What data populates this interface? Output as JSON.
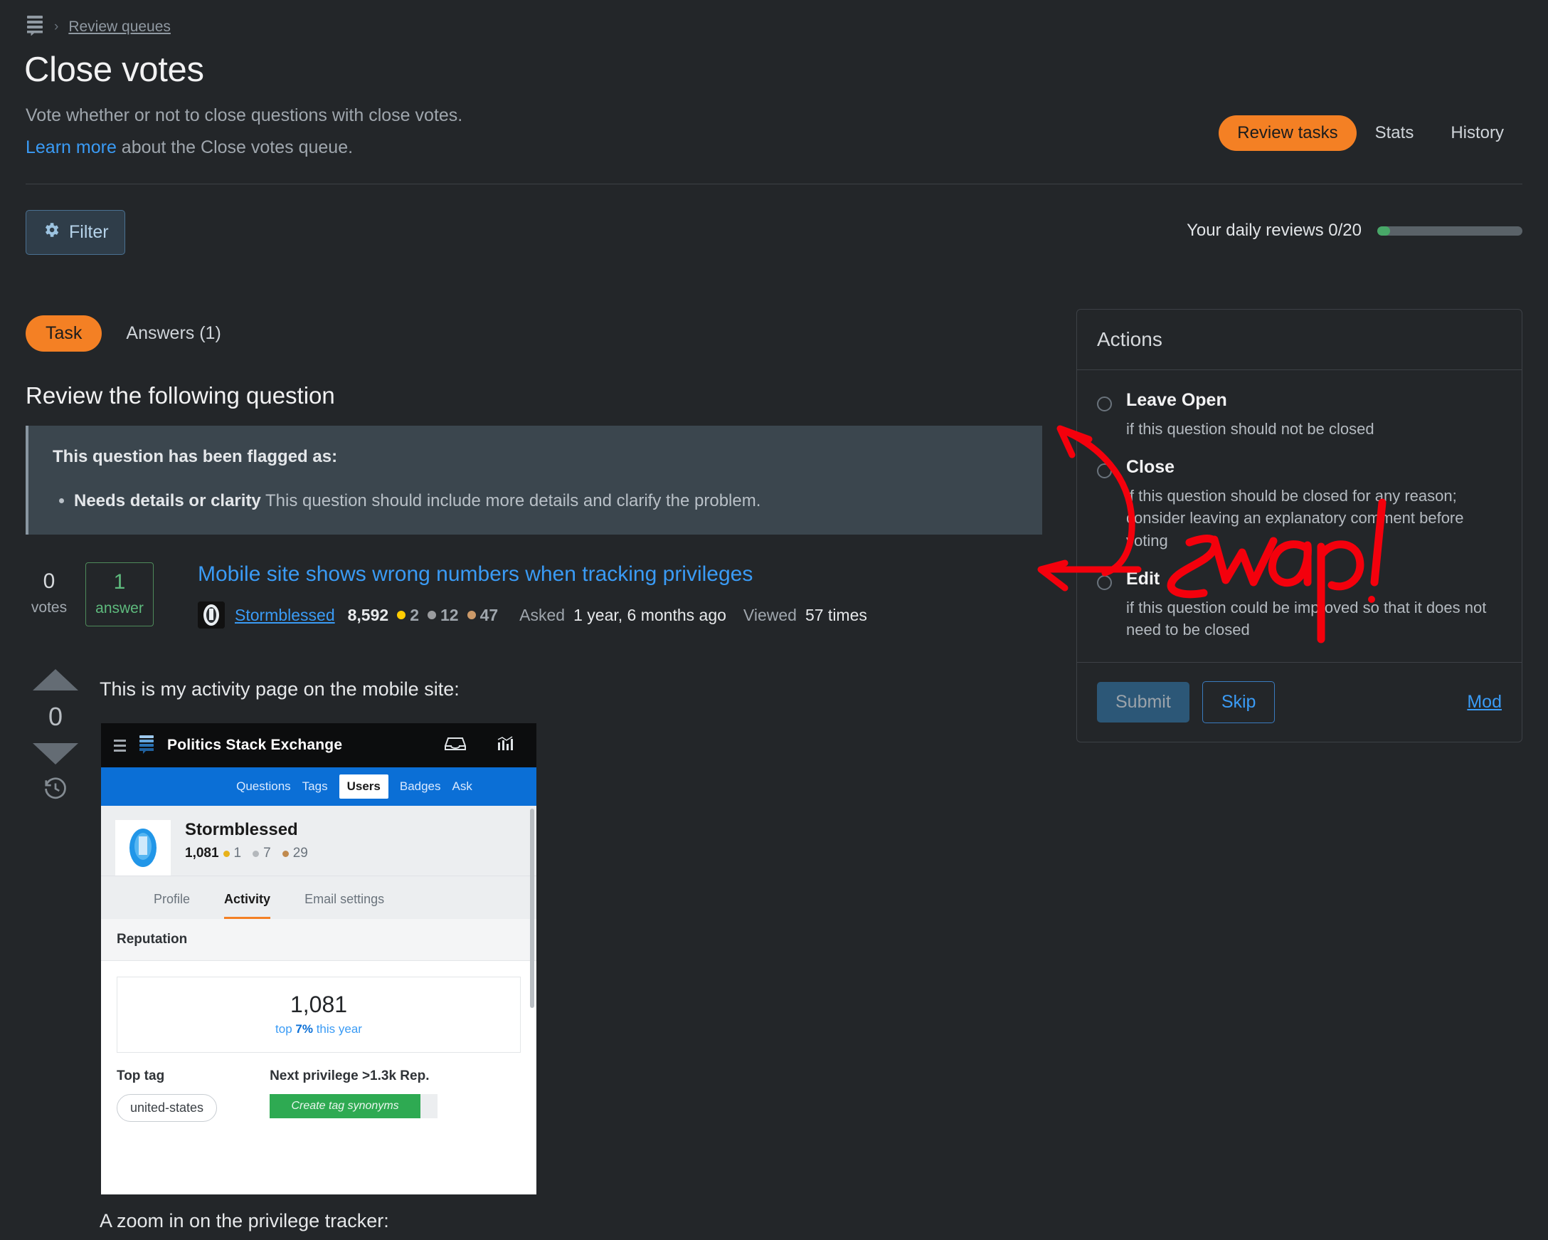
{
  "breadcrumb": {
    "logo": "stack-exchange-logo",
    "separator": "›",
    "item": "Review queues"
  },
  "header": {
    "title": "Close votes",
    "subtitle": "Vote whether or not to close questions with close votes.",
    "learn_more": "Learn more",
    "learn_more_rest": " about the Close votes queue."
  },
  "topnav": {
    "review_tasks": "Review tasks",
    "stats": "Stats",
    "history": "History",
    "accent": "#f48024"
  },
  "toolbar": {
    "filter_label": "Filter",
    "daily_label": "Your daily reviews 0/20",
    "daily_done": 0,
    "daily_total": 20
  },
  "tabs": {
    "task": "Task",
    "answers": "Answers (1)"
  },
  "main": {
    "section_title": "Review the following question",
    "flag_heading": "This question has been flagged as:",
    "flag_items": [
      {
        "title": "Needs details or clarity",
        "desc": "This question should include more details and clarify the problem."
      }
    ],
    "question": {
      "votes": "0",
      "votes_label": "votes",
      "answers": "1",
      "answers_label": "answer",
      "title": "Mobile site shows wrong numbers when tracking privileges",
      "user": "Stormblessed",
      "reputation": "8,592",
      "gold": "2",
      "silver": "12",
      "bronze": "47",
      "asked_label": "Asked",
      "asked_value": "1 year, 6 months ago",
      "viewed_label": "Viewed",
      "viewed_value": "57 times"
    },
    "post_vote_count": "0",
    "body_paragraph_1": "This is my activity page on the mobile site:",
    "body_paragraph_2": "A zoom in on the privilege tracker:"
  },
  "embedded_screenshot": {
    "site_name": "Politics Stack Exchange",
    "nav": [
      "Questions",
      "Tags",
      "Users",
      "Badges",
      "Ask"
    ],
    "nav_selected": "Users",
    "username": "Stormblessed",
    "reputation": "1,081",
    "gold": "1",
    "silver": "7",
    "bronze": "29",
    "profile_tabs": [
      "Profile",
      "Activity",
      "Email settings"
    ],
    "profile_tab_selected": "Activity",
    "reputation_header": "Reputation",
    "reputation_value": "1,081",
    "reputation_sub_pre": "top ",
    "reputation_sub_pct": "7%",
    "reputation_sub_post": " this year",
    "top_tag_label": "Top tag",
    "top_tag": "united-states",
    "next_privilege_label": "Next privilege >1.3k Rep.",
    "next_privilege_button": "Create tag synonyms"
  },
  "actions": {
    "heading": "Actions",
    "options": [
      {
        "label": "Leave Open",
        "desc": "if this question should not be closed"
      },
      {
        "label": "Close",
        "desc": "if this question should be closed for any reason; consider leaving an explanatory comment before voting"
      },
      {
        "label": "Edit",
        "desc": "if this question could be improved so that it does not need to be closed"
      }
    ],
    "submit": "Submit",
    "skip": "Skip",
    "mod": "Mod"
  },
  "annotation": {
    "text": "Swap!",
    "color": "#f4000c"
  }
}
